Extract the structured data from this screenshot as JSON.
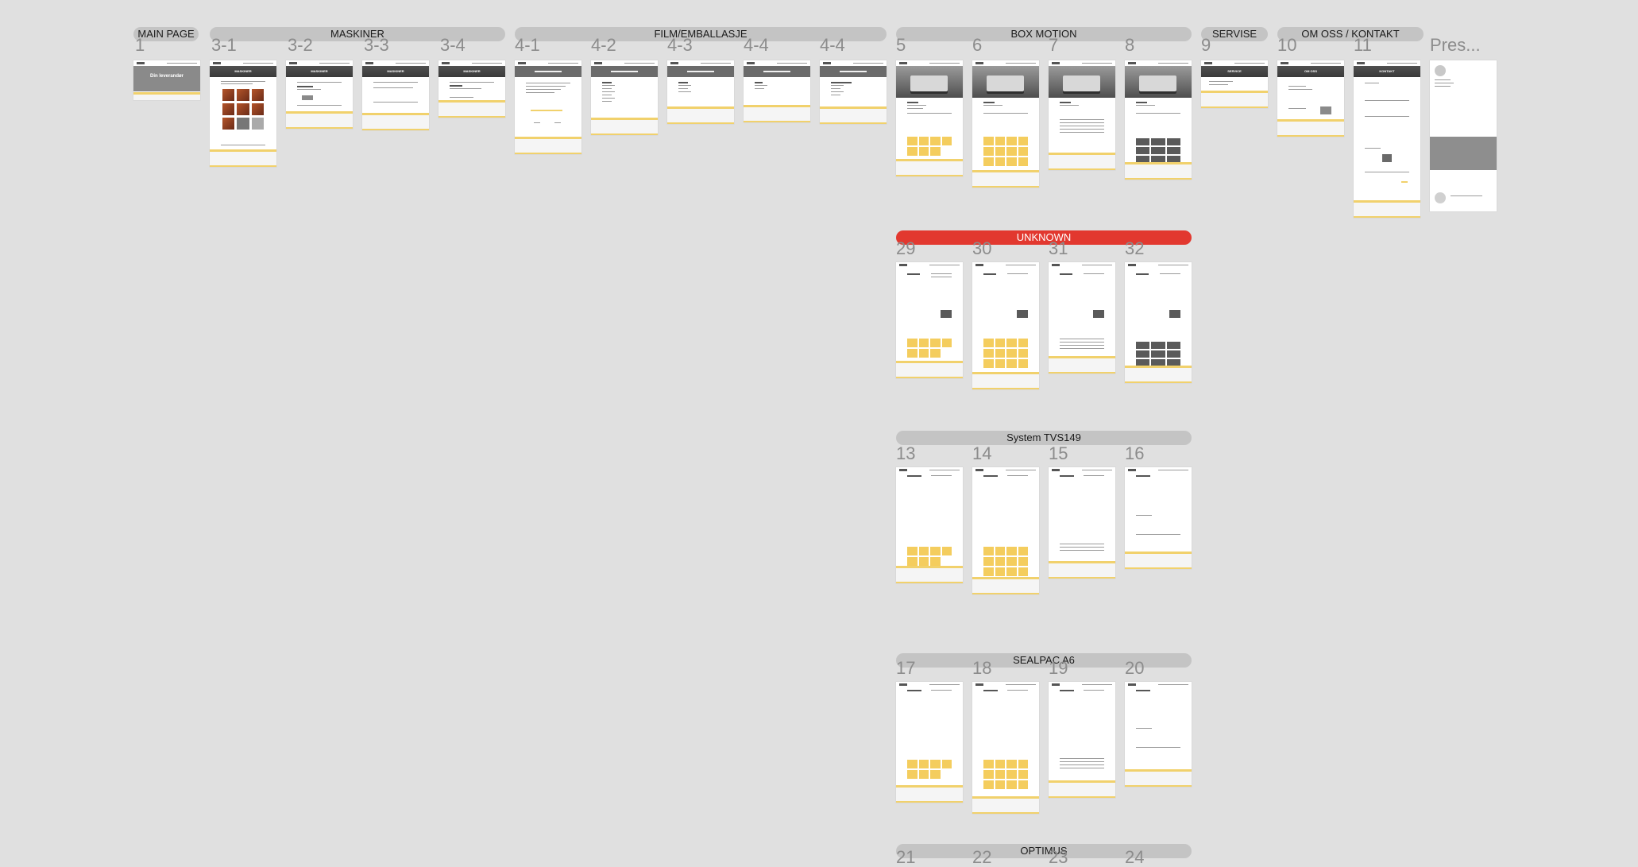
{
  "canvas": {
    "background": "#e0e0e0"
  },
  "sections": [
    {
      "id": "main-page",
      "title": "MAIN PAGE"
    },
    {
      "id": "maskiner",
      "title": "MASKINER"
    },
    {
      "id": "film-emballasje",
      "title": "FILM/EMBALLASJE"
    },
    {
      "id": "box-motion",
      "title": "BOX MOTION"
    },
    {
      "id": "servise",
      "title": "SERVISE"
    },
    {
      "id": "om-oss-kontakt",
      "title": "OM OSS / KONTAKT"
    },
    {
      "id": "unknown",
      "title": "UNKNOWN",
      "color": "#e2382f"
    },
    {
      "id": "system-tvs149",
      "title": "System TVS149"
    },
    {
      "id": "sealpac-a6",
      "title": "SEALPAC A6"
    },
    {
      "id": "optimus",
      "title": "OPTIMUS"
    }
  ],
  "frames": [
    {
      "label": "1",
      "hero_text": "Din leverandør"
    },
    {
      "label": "3-1",
      "hero_text": "MASKINER"
    },
    {
      "label": "3-2",
      "hero_text": "MASKINER"
    },
    {
      "label": "3-3",
      "hero_text": "MASKINER"
    },
    {
      "label": "3-4",
      "hero_text": "MASKINER"
    },
    {
      "label": "4-1"
    },
    {
      "label": "4-2"
    },
    {
      "label": "4-3"
    },
    {
      "label": "4-4"
    },
    {
      "label": "4-4"
    },
    {
      "label": "5"
    },
    {
      "label": "6"
    },
    {
      "label": "7"
    },
    {
      "label": "8"
    },
    {
      "label": "9",
      "hero_text": "SERVICE"
    },
    {
      "label": "10",
      "hero_text": "OM OSS"
    },
    {
      "label": "11",
      "hero_text": "KONTAKT"
    },
    {
      "label": "Pres..."
    },
    {
      "label": "29"
    },
    {
      "label": "30"
    },
    {
      "label": "31"
    },
    {
      "label": "32"
    },
    {
      "label": "13"
    },
    {
      "label": "14"
    },
    {
      "label": "15"
    },
    {
      "label": "16"
    },
    {
      "label": "17"
    },
    {
      "label": "18"
    },
    {
      "label": "19"
    },
    {
      "label": "20"
    },
    {
      "label": "21"
    },
    {
      "label": "22"
    },
    {
      "label": "23"
    },
    {
      "label": "24"
    }
  ]
}
